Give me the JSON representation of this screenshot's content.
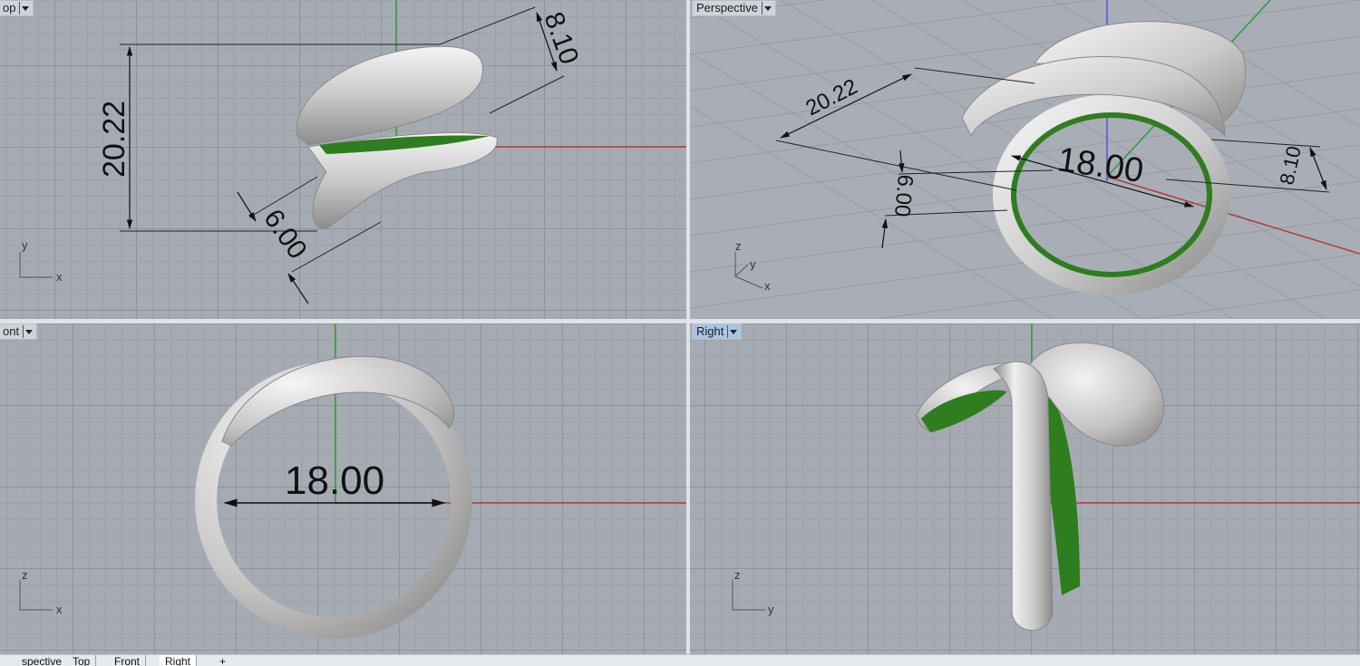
{
  "viewports": {
    "top": {
      "label": "op"
    },
    "perspective": {
      "label": "Perspective"
    },
    "front": {
      "label": "ont"
    },
    "right": {
      "label": "Right"
    }
  },
  "dimensions": {
    "top_height": "20.22",
    "top_thickness": "8.10",
    "top_width": "6.00",
    "persp_length": "20.22",
    "persp_inner": "18.00",
    "persp_width": "6.00",
    "persp_thickness": "8.10",
    "front_inner": "18.00"
  },
  "axes": {
    "top": [
      "y",
      "x"
    ],
    "perspective": [
      "z",
      "y",
      "x"
    ],
    "front": [
      "z",
      "x"
    ],
    "right": [
      "z",
      "y"
    ]
  },
  "tabs": [
    "spective",
    "Top",
    "Front",
    "Right",
    "+"
  ],
  "colors": {
    "x_axis": "#b33a3a",
    "y_axis": "#2f9a3a",
    "z_axis": "#4a5bd6",
    "metal": "#d2d2d2",
    "inner": "#2e7d1e"
  }
}
